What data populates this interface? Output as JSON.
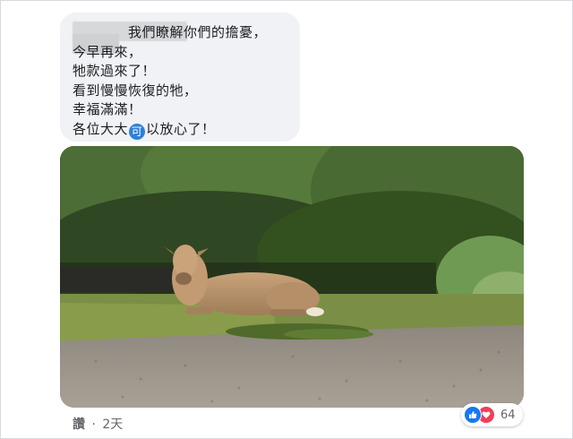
{
  "comment": {
    "lines": [
      "我們瞭解你們的擔憂，",
      "今早再來，",
      "牠款過來了！",
      "看到慢慢恢復的牠，",
      "幸福滿滿！"
    ],
    "last_line_prefix": "各位大大",
    "emoji_char": "可",
    "last_line_suffix": "以放心了！"
  },
  "photo": {
    "subject": "cow resting on roadside under trees"
  },
  "actions": {
    "like_label": "讚",
    "separator": "·",
    "time": "2天"
  },
  "reactions": {
    "icons": [
      "like-icon",
      "love-icon"
    ],
    "count": "64",
    "like_color": "#1877f2",
    "love_color": "#f33e58"
  }
}
